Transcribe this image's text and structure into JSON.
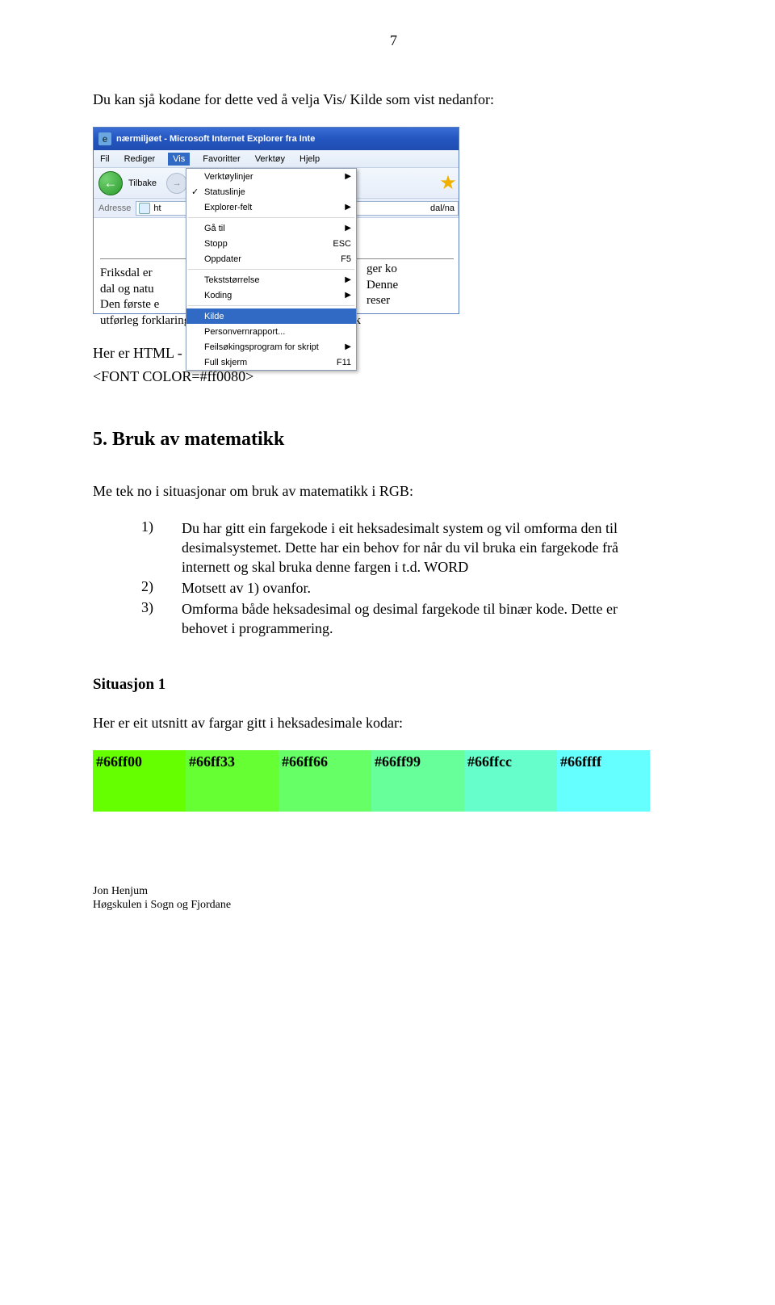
{
  "pageNumber": "7",
  "intro": "Du kan sjå kodane for dette ved å velja Vis/ Kilde som vist nedanfor:",
  "afterShot1": "Her er HTML - koden for teksten \"Friksdal\"",
  "fontTag": "<FONT COLOR=#ff0080>",
  "sectionHead": "5. Bruk av matematikk",
  "listIntro": "Me tek no i  situasjonar om bruk av matematikk i RGB:",
  "items": [
    {
      "n": "1)",
      "t": "Du har gitt ein fargekode i eit heksadesimalt system og vil omforma den til desimalsystemet. Dette har ein behov for når du vil bruka ein  fargekode frå internett og skal bruka denne fargen i t.d. WORD"
    },
    {
      "n": "2)",
      "t": "Motsett av 1) ovanfor."
    },
    {
      "n": "3)",
      "t": "Omforma både heksadesimal og desimal fargekode til binær kode. Dette er behovet i programmering."
    }
  ],
  "subHead": "Situasjon 1",
  "swatchIntro": "Her er eit utsnitt av fargar gitt i heksadesimale kodar:",
  "swatches": [
    {
      "hex": "#66ff00",
      "bg": "#66ff00"
    },
    {
      "hex": "#66ff33",
      "bg": "#66ff33"
    },
    {
      "hex": "#66ff66",
      "bg": "#66ff66"
    },
    {
      "hex": "#66ff99",
      "bg": "#66ff99"
    },
    {
      "hex": "#66ffcc",
      "bg": "#66ffcc"
    },
    {
      "hex": "#66ffff",
      "bg": "#66ffff"
    }
  ],
  "footer": {
    "l1": "Jon Henjum",
    "l2": "Høgskulen i Sogn og Fjordane"
  },
  "ie": {
    "title": "nærmiljøet - Microsoft Internet Explorer fra Inte",
    "menus": [
      "Fil",
      "Rediger",
      "Vis",
      "Favoritter",
      "Verktøy",
      "Hjelp"
    ],
    "back": "Tilbake",
    "addrLabel": "Adresse",
    "addrText": "ht",
    "addrRight": "dal/na",
    "dropdown": {
      "g1": [
        {
          "label": "Verktøylinjer",
          "arrow": true
        },
        {
          "label": "Statuslinje",
          "check": true
        },
        {
          "label": "Explorer-felt",
          "arrow": true
        }
      ],
      "g2": [
        {
          "label": "Gå til",
          "arrow": true
        },
        {
          "label": "Stopp",
          "kbd": "ESC"
        },
        {
          "label": "Oppdater",
          "kbd": "F5"
        }
      ],
      "g3": [
        {
          "label": "Tekststørrelse",
          "arrow": true
        },
        {
          "label": "Koding",
          "arrow": true
        }
      ],
      "g4": [
        {
          "label": "Kilde",
          "selected": true
        },
        {
          "label": "Personvernrapport..."
        },
        {
          "label": "Feilsøkingsprogram for skript",
          "arrow": true
        },
        {
          "label": "Full skjerm",
          "kbd": "F11"
        }
      ]
    },
    "content": {
      "left": "Friksdal er dal og natu Den første e utførleg forklaring til kulturspora med ei spesiell vink",
      "leftLines": [
        "Friksdal er",
        "dal og natu",
        "Den første e",
        "utførleg forklaring til kulturspora med ei spesiell vink"
      ],
      "right": [
        "ger ko",
        "Denne",
        "reser"
      ]
    }
  }
}
